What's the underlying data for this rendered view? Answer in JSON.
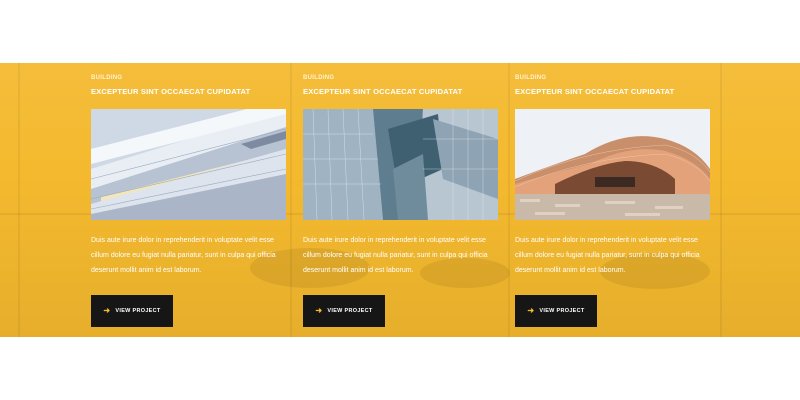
{
  "colors": {
    "accent": "#f4b92e",
    "button_bg": "#161616",
    "text_light": "#ffffff"
  },
  "projects": [
    {
      "category": "BUILDING",
      "title": "EXCEPTEUR SINT OCCAECAT CUPIDATAT",
      "image": "building-facade-image",
      "description": "Duis aute irure dolor in reprehenderit in voluptate velit esse cillum dolore eu fugiat nulla pariatur, sunt in culpa qui officia deserunt mollit anim id est laborum.",
      "button_label": "VIEW PROJECT",
      "button_icon": "arrow-right-icon"
    },
    {
      "category": "BUILDING",
      "title": "EXCEPTEUR SINT OCCAECAT CUPIDATAT",
      "image": "glass-building-image",
      "description": "Duis aute irure dolor in reprehenderit in voluptate velit esse cillum dolore eu fugiat nulla pariatur, sunt in culpa qui officia deserunt mollit anim id est laborum.",
      "button_label": "VIEW PROJECT",
      "button_icon": "arrow-right-icon"
    },
    {
      "category": "BUILDING",
      "title": "EXCEPTEUR SINT OCCAECAT CUPIDATAT",
      "image": "curved-roof-building-image",
      "description": "Duis aute irure dolor in reprehenderit in voluptate velit esse cillum dolore eu fugiat nulla pariatur, sunt in culpa qui officia deserunt mollit anim id est laborum.",
      "button_label": "VIEW PROJECT",
      "button_icon": "arrow-right-icon"
    }
  ]
}
